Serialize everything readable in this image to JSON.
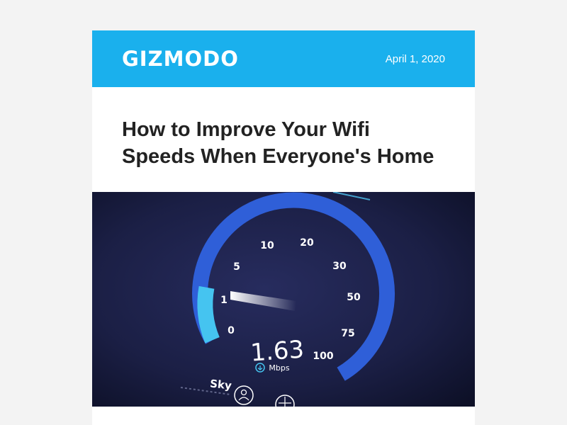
{
  "header": {
    "logo": "GIZMODO",
    "date": "April 1, 2020",
    "background_color": "#1ab0ed"
  },
  "article": {
    "title_line1": "How to Improve Your Wifi",
    "title_line2": "Speeds When Everyone's Home"
  },
  "hero_image": {
    "gauge_ticks": [
      "0",
      "1",
      "5",
      "10",
      "20",
      "30",
      "50",
      "75",
      "100"
    ],
    "speed_value": "1.63",
    "speed_unit": "Mbps",
    "provider": "Sky",
    "progress_fraction": 0.08,
    "colors": {
      "background": "#1b1f45",
      "arc": "#2f5fd8",
      "arc_active": "#45c4f0"
    }
  }
}
